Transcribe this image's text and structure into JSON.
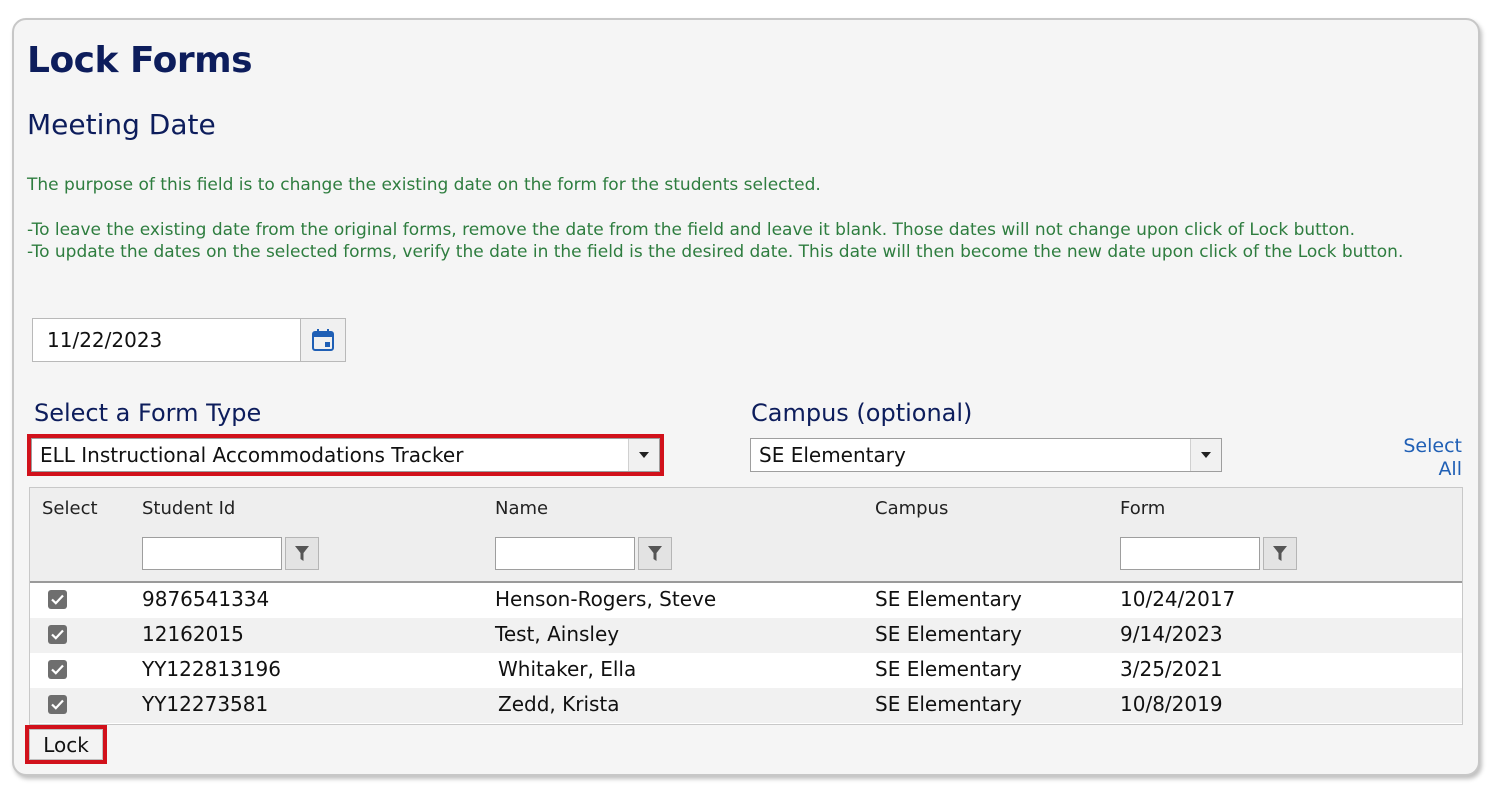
{
  "page": {
    "title": "Lock Forms",
    "subtitle": "Meeting Date",
    "notes": [
      "The purpose of this field is to change the existing date on the form for the students selected.",
      "-To leave the existing date from the original forms, remove the date from the field and leave it blank. Those dates will not change upon click of Lock button.",
      "-To update the dates on the selected forms, verify the date in the field is the desired date. This date will then become the new date upon click of the Lock button."
    ]
  },
  "date_field": {
    "value": "11/22/2023",
    "icon": "calendar-icon"
  },
  "form_type": {
    "label": "Select a Form Type",
    "selected": "ELL Instructional Accommodations Tracker"
  },
  "campus": {
    "label": "Campus (optional)",
    "selected": "SE Elementary"
  },
  "select_all": {
    "line1": "Select",
    "line2": "All"
  },
  "table": {
    "headers": {
      "select": "Select",
      "student_id": "Student Id",
      "name": "Name",
      "campus": "Campus",
      "form": "Form"
    },
    "rows": [
      {
        "student_id": "9876541334",
        "name": "Henson-Rogers, Steve",
        "campus": "SE Elementary",
        "form": "10/24/2017",
        "checked": true
      },
      {
        "student_id": "12162015",
        "name": "Test, Ainsley",
        "campus": "SE Elementary",
        "form": "9/14/2023",
        "checked": true
      },
      {
        "student_id": "YY122813196",
        "name": "Whitaker, Ella",
        "campus": "SE Elementary",
        "form": "3/25/2021",
        "checked": true
      },
      {
        "student_id": "YY12273581",
        "name": "Zedd, Krista",
        "campus": "SE Elementary",
        "form": "10/8/2019",
        "checked": true
      }
    ]
  },
  "lock_button": {
    "label": "Lock"
  },
  "colors": {
    "heading": "#0d1d5c",
    "note": "#2e7d3f",
    "highlight": "#d1111b",
    "link": "#1f5fb5"
  }
}
